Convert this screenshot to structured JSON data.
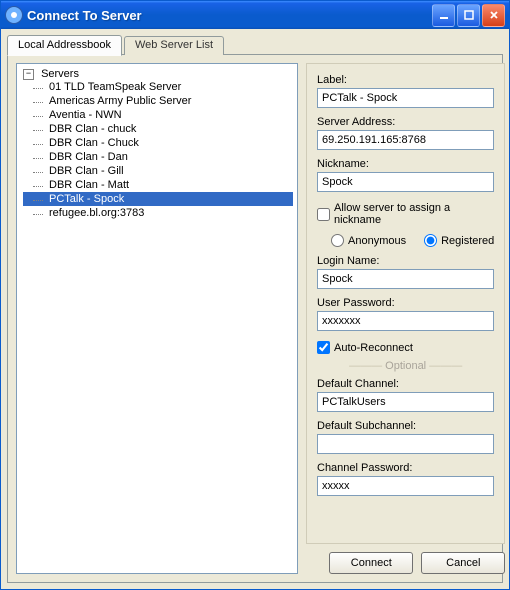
{
  "window": {
    "title": "Connect To Server"
  },
  "tabs": {
    "local": "Local Addressbook",
    "web": "Web Server List"
  },
  "tree": {
    "root": "Servers",
    "items": [
      "01 TLD TeamSpeak Server",
      "Americas Army Public Server",
      "Aventia - NWN",
      "DBR Clan - chuck",
      "DBR Clan - Chuck",
      "DBR Clan - Dan",
      "DBR Clan - Gill",
      "DBR Clan - Matt",
      "PCTalk - Spock",
      "refugee.bl.org:3783"
    ],
    "selected_index": 8
  },
  "form": {
    "label_label": "Label:",
    "label_value": "PCTalk - Spock",
    "addr_label": "Server Address:",
    "addr_value": "69.250.191.165:8768",
    "nick_label": "Nickname:",
    "nick_value": "Spock",
    "allow_label": "Allow server to assign a nickname",
    "allow_checked": false,
    "anon_label": "Anonymous",
    "reg_label": "Registered",
    "identity": "registered",
    "login_label": "Login Name:",
    "login_value": "Spock",
    "upw_label": "User Password:",
    "upw_value": "xxxxxxx",
    "auto_label": "Auto-Reconnect",
    "auto_checked": true,
    "optional": "Optional",
    "dch_label": "Default Channel:",
    "dch_value": "PCTalkUsers",
    "dsub_label": "Default Subchannel:",
    "dsub_value": "",
    "cpw_label": "Channel Password:",
    "cpw_value": "xxxxx"
  },
  "buttons": {
    "connect": "Connect",
    "cancel": "Cancel"
  }
}
